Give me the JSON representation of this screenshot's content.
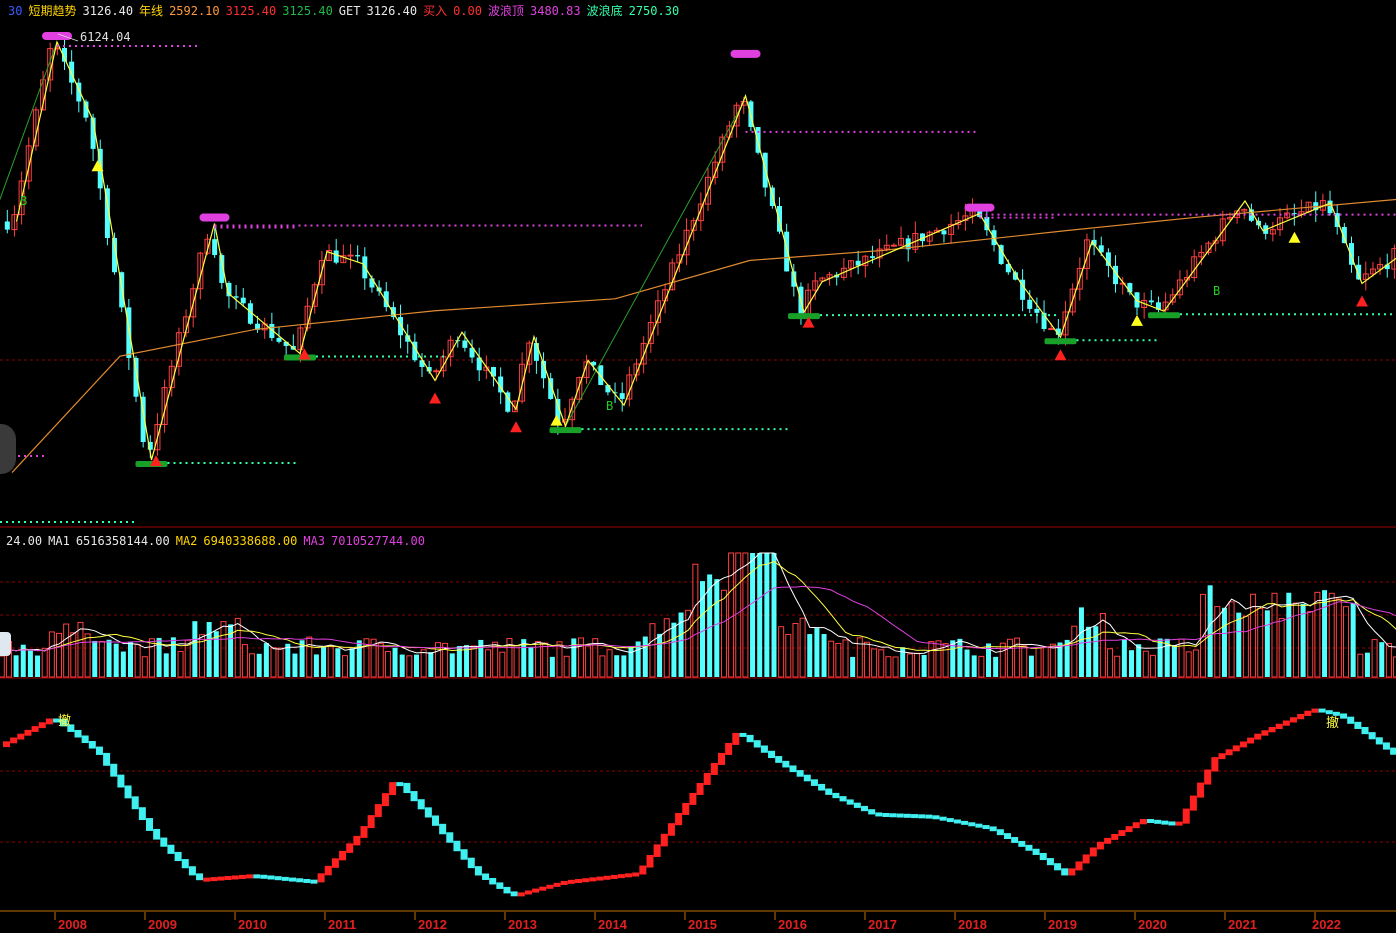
{
  "legend_top": [
    {
      "text": "30",
      "color": "#3b5bff"
    },
    {
      "text": "短期趋势",
      "color": "#ffd400"
    },
    {
      "text": "3126.40",
      "color": "#e8e8e8"
    },
    {
      "text": "年线",
      "color": "#ffd400"
    },
    {
      "text": "2592.10",
      "color": "#ff9a3c"
    },
    {
      "text": "3125.40",
      "color": "#ff3030"
    },
    {
      "text": "3125.40",
      "color": "#1fb84a"
    },
    {
      "text": "GET",
      "color": "#e8e8e8"
    },
    {
      "text": "3126.40",
      "color": "#e8e8e8"
    },
    {
      "text": "买入",
      "color": "#ff3030"
    },
    {
      "text": "0.00",
      "color": "#ff3030"
    },
    {
      "text": "波浪顶",
      "color": "#e040e0"
    },
    {
      "text": "3480.83",
      "color": "#e040e0"
    },
    {
      "text": "波浪底",
      "color": "#33ffaa"
    },
    {
      "text": "2750.30",
      "color": "#33ffaa"
    }
  ],
  "legend_vol": [
    {
      "text": "24.00",
      "color": "#e8e8e8"
    },
    {
      "text": "MA1",
      "color": "#e8e8e8"
    },
    {
      "text": "6516358144.00",
      "color": "#e8e8e8"
    },
    {
      "text": "MA2",
      "color": "#ffd400"
    },
    {
      "text": "6940338688.00",
      "color": "#ffd400"
    },
    {
      "text": "MA3",
      "color": "#e040e0"
    },
    {
      "text": "7010527744.00",
      "color": "#e040e0"
    }
  ],
  "peak_label": "6124.04",
  "signal_buy": "B",
  "signal_cancel": "撤",
  "colors": {
    "up": "#ff4040",
    "down": "#54ffff",
    "zigzag": "#ffff40",
    "annual": "#e08a30",
    "top_line": "#e040e0",
    "bottom_line": "#33ffaa",
    "grid": "#8a0000"
  },
  "chart_data": [
    {
      "type": "candlestick",
      "x_axis": [
        "2008",
        "2009",
        "2010",
        "2011",
        "2012",
        "2013",
        "2014",
        "2015",
        "2016",
        "2017",
        "2018",
        "2019",
        "2020",
        "2021",
        "2022"
      ],
      "ylim": [
        1300,
        6300
      ],
      "zigzag": [
        [
          2007.35,
          3500
        ],
        [
          2007.8,
          6124
        ],
        [
          2008.2,
          4800
        ],
        [
          2008.85,
          1664
        ],
        [
          2009.55,
          3478
        ],
        [
          2009.7,
          2800
        ],
        [
          2010.5,
          2319
        ],
        [
          2010.8,
          3186
        ],
        [
          2011.2,
          3067
        ],
        [
          2012.0,
          2132
        ],
        [
          2012.3,
          2478
        ],
        [
          2012.9,
          1949
        ],
        [
          2013.1,
          2444
        ],
        [
          2013.45,
          1849
        ],
        [
          2013.7,
          2270
        ],
        [
          2014.1,
          1974
        ],
        [
          2015.45,
          5178
        ],
        [
          2016.1,
          2638
        ],
        [
          2016.3,
          2900
        ],
        [
          2018.05,
          3587
        ],
        [
          2018.5,
          2900
        ],
        [
          2018.95,
          2440
        ],
        [
          2019.3,
          3288
        ],
        [
          2019.8,
          2733
        ],
        [
          2020.1,
          2646
        ],
        [
          2021.0,
          3731
        ],
        [
          2021.2,
          3400
        ],
        [
          2021.95,
          3708
        ],
        [
          2022.3,
          2885
        ],
        [
          2022.8,
          3200
        ]
      ],
      "wave_tops": [
        6124,
        3478,
        5178,
        3587
      ],
      "wave_bottoms": [
        1664,
        2319,
        1849,
        2638,
        2440,
        2646
      ],
      "buy_marks_red": [
        2008.9,
        2010.55,
        2012.0,
        2012.9,
        2016.15,
        2018.95,
        2022.3
      ],
      "buy_marks_yellow": [
        2008.25,
        2013.35,
        2019.8,
        2021.55
      ],
      "annual_line": [
        [
          2007.3,
          1600
        ],
        [
          2008.5,
          2300
        ],
        [
          2010.0,
          2500
        ],
        [
          2012.0,
          2650
        ],
        [
          2014.0,
          2750
        ],
        [
          2015.5,
          3100
        ],
        [
          2017.0,
          3200
        ],
        [
          2019.0,
          3400
        ],
        [
          2020.5,
          3550
        ],
        [
          2022.7,
          3750
        ]
      ]
    },
    {
      "type": "bar",
      "title": "MA1 MA2 MA3"
    },
    {
      "type": "indicator",
      "curve": [
        [
          2007.2,
          0.78
        ],
        [
          2007.8,
          0.92
        ],
        [
          2008.3,
          0.75
        ],
        [
          2008.9,
          0.35
        ],
        [
          2009.4,
          0.13
        ],
        [
          2010.0,
          0.15
        ],
        [
          2010.7,
          0.12
        ],
        [
          2011.2,
          0.35
        ],
        [
          2011.6,
          0.62
        ],
        [
          2012.0,
          0.42
        ],
        [
          2012.5,
          0.16
        ],
        [
          2012.9,
          0.05
        ],
        [
          2013.5,
          0.12
        ],
        [
          2014.3,
          0.16
        ],
        [
          2014.7,
          0.42
        ],
        [
          2015.4,
          0.85
        ],
        [
          2015.8,
          0.72
        ],
        [
          2016.4,
          0.55
        ],
        [
          2016.9,
          0.45
        ],
        [
          2017.5,
          0.44
        ],
        [
          2018.2,
          0.38
        ],
        [
          2018.7,
          0.26
        ],
        [
          2019.05,
          0.15
        ],
        [
          2019.4,
          0.3
        ],
        [
          2019.9,
          0.42
        ],
        [
          2020.3,
          0.4
        ],
        [
          2020.7,
          0.72
        ],
        [
          2021.2,
          0.84
        ],
        [
          2021.8,
          0.96
        ],
        [
          2022.1,
          0.93
        ],
        [
          2022.7,
          0.74
        ]
      ]
    }
  ]
}
